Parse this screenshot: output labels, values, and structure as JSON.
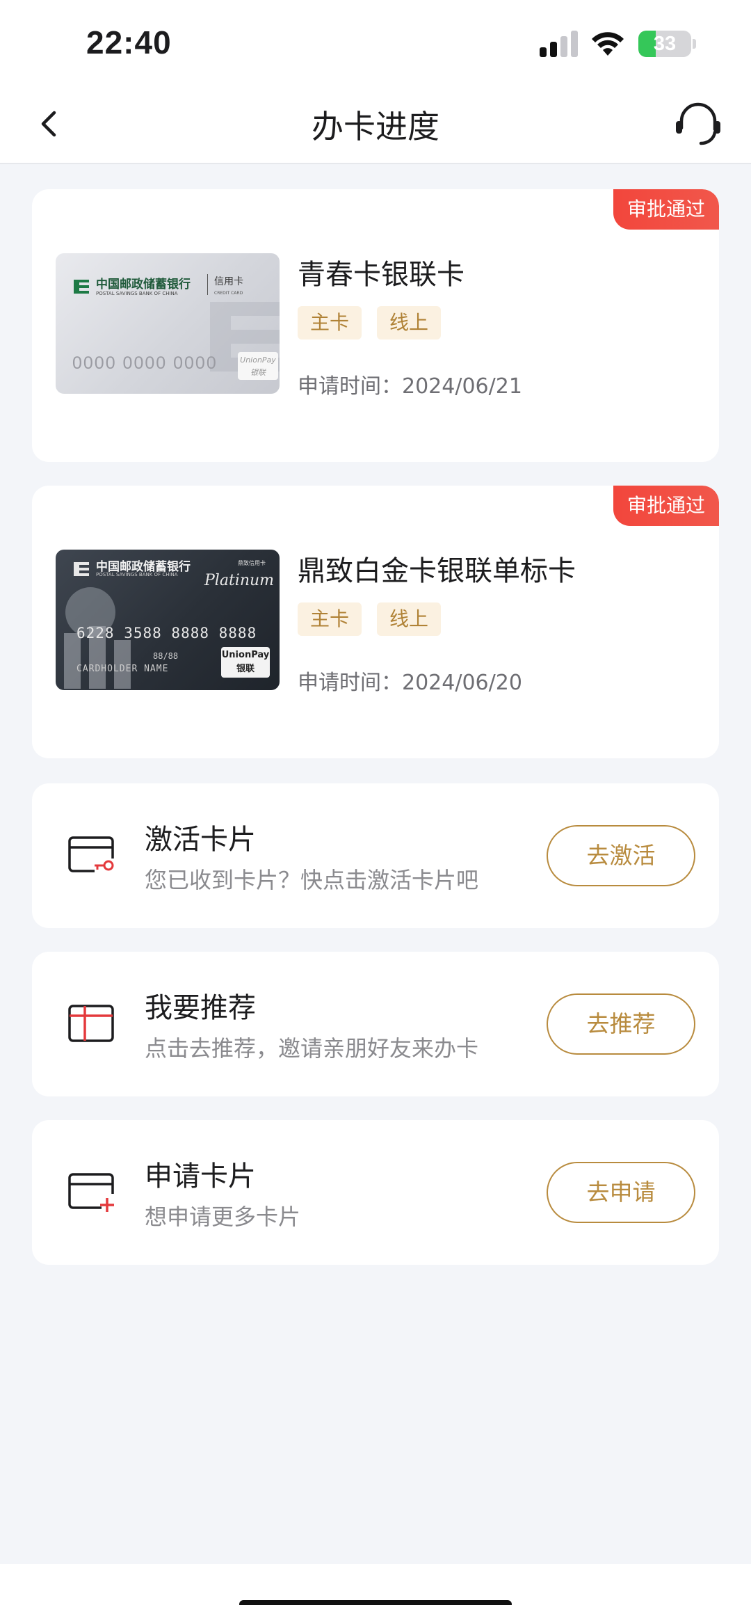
{
  "status_bar": {
    "time": "22:40",
    "battery": "33",
    "battery_level": 0.33
  },
  "nav": {
    "title": "办卡进度",
    "back_icon": "chevron-left-icon",
    "service_icon": "headset-icon"
  },
  "applications": [
    {
      "status": "审批通过",
      "name": "青春卡银联卡",
      "tags": [
        "主卡",
        "线上"
      ],
      "apply_date": "申请时间：2024/06/21",
      "card_art": {
        "bank_cn": "中国邮政储蓄银行",
        "bank_en": "POSTAL SAVINGS BANK OF CHINA",
        "credit_cn": "信用卡",
        "credit_en": "CREDIT CARD",
        "number": "0000 0000 0000",
        "network": "UnionPay 银联"
      }
    },
    {
      "status": "审批通过",
      "name": "鼎致白金卡银联单标卡",
      "tags": [
        "主卡",
        "线上"
      ],
      "apply_date": "申请时间：2024/06/20",
      "card_art": {
        "bank_cn": "中国邮政储蓄银行",
        "bank_en": "POSTAL SAVINGS BANK OF CHINA",
        "credit_cn": "鼎致信用卡",
        "platinum": "Platinum",
        "number": "6228 3588 8888 8888",
        "valid": "88/88",
        "holder": "CARDHOLDER NAME",
        "network_en": "UnionPay",
        "network_cn": "银联"
      }
    }
  ],
  "actions": [
    {
      "title": "激活卡片",
      "desc": "您已收到卡片？快点击激活卡片吧",
      "button": "去激活",
      "icon": "card-activate-icon"
    },
    {
      "title": "我要推荐",
      "desc": "点击去推荐，邀请亲朋好友来办卡",
      "button": "去推荐",
      "icon": "gift-icon"
    },
    {
      "title": "申请卡片",
      "desc": "想申请更多卡片",
      "button": "去申请",
      "icon": "card-add-icon"
    }
  ],
  "colors": {
    "accent": "#b88b3e",
    "badge": "#f2463c",
    "tag_bg": "#fbf1e1"
  }
}
